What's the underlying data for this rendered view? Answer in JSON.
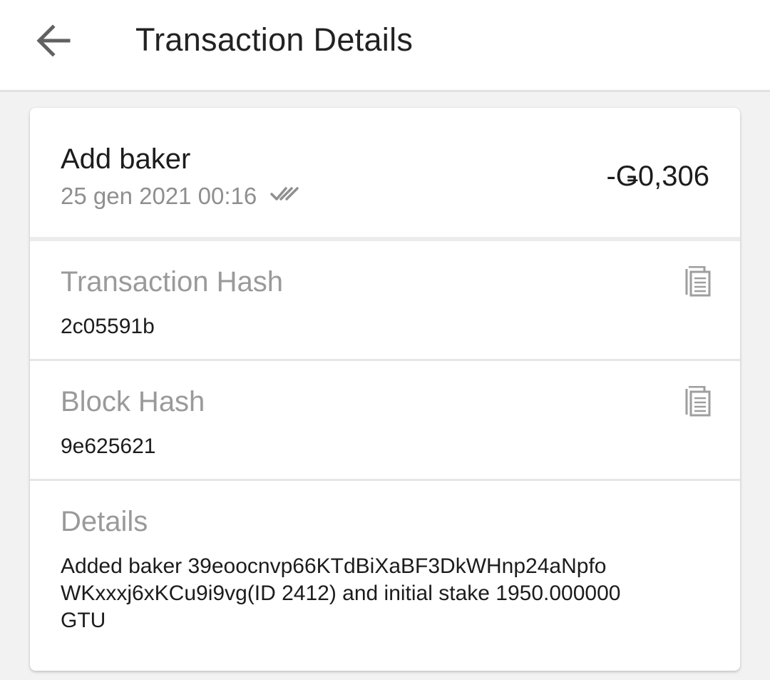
{
  "appbar": {
    "title": "Transaction Details",
    "back_icon": "arrow-back-icon"
  },
  "transaction": {
    "title": "Add baker",
    "date": "25 gen 2021 00:16",
    "status_icon": "double-check-icon",
    "amount": "-Ǥ0,306"
  },
  "sections": {
    "transaction_hash": {
      "label": "Transaction Hash",
      "value": "2c05591b",
      "copy_icon": "copy-icon"
    },
    "block_hash": {
      "label": "Block Hash",
      "value": "9e625621",
      "copy_icon": "copy-icon"
    },
    "details": {
      "label": "Details",
      "lines": [
        "Added baker 39eoocnvp66KTdBiXaBF3DkWHnp24aNpfo",
        "WKxxxj6xKCu9i9vg(ID 2412) and initial stake 1950.000000",
        "GTU"
      ]
    }
  },
  "colors": {
    "text_primary": "#1c1c1c",
    "text_secondary": "#9a9a9a",
    "background": "#f2f2f2",
    "card": "#ffffff"
  }
}
